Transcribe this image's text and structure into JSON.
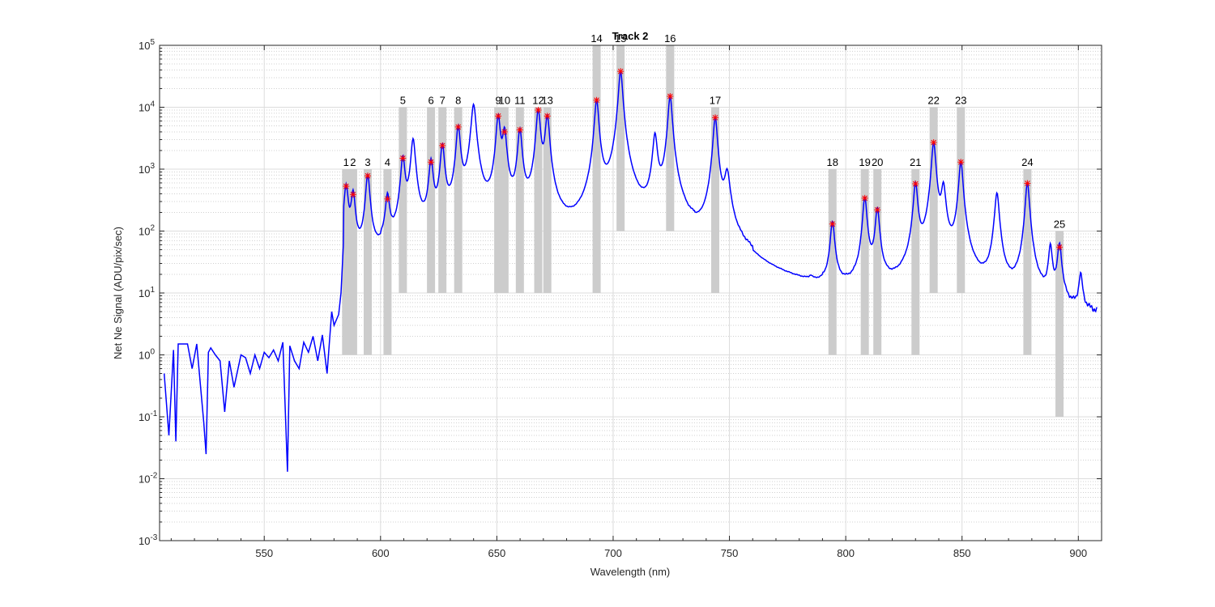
{
  "chart_data": {
    "type": "line",
    "title": "Track 2",
    "xlabel": "Wavelength (nm)",
    "ylabel": "Net Ne Signal (ADU/pix/sec)",
    "xlim": [
      505,
      910
    ],
    "ylim": [
      0.001,
      100000
    ],
    "yscale": "log",
    "grid": true,
    "minor_grid": true,
    "x_ticks": [
      550,
      600,
      650,
      700,
      750,
      800,
      850,
      900
    ],
    "x_tick_labels": [
      "550",
      "600",
      "650",
      "700",
      "750",
      "800",
      "850",
      "900"
    ],
    "y_ticks": [
      {
        "base": "10",
        "exp": "-3",
        "value": 0.001
      },
      {
        "base": "10",
        "exp": "-2",
        "value": 0.01
      },
      {
        "base": "10",
        "exp": "-1",
        "value": 0.1
      },
      {
        "base": "10",
        "exp": "0",
        "value": 1
      },
      {
        "base": "10",
        "exp": "1",
        "value": 10
      },
      {
        "base": "10",
        "exp": "2",
        "value": 100
      },
      {
        "base": "10",
        "exp": "3",
        "value": 1000
      },
      {
        "base": "10",
        "exp": "4",
        "value": 10000
      },
      {
        "base": "10",
        "exp": "5",
        "value": 100000
      }
    ],
    "series_color": "#0000ff",
    "marker_color": "#ff0000",
    "band_color": "#cccccc",
    "background_spectrum": [
      [
        507,
        0.5
      ],
      [
        509,
        0.05
      ],
      [
        511,
        1.2
      ],
      [
        512,
        0.04
      ],
      [
        513,
        1.5
      ],
      [
        517,
        1.5
      ],
      [
        519,
        0.6
      ],
      [
        521,
        1.5
      ],
      [
        524,
        0.08
      ],
      [
        525,
        0.025
      ],
      [
        526,
        1.1
      ],
      [
        527,
        1.3
      ],
      [
        529,
        1.0
      ],
      [
        531,
        0.8
      ],
      [
        533,
        0.12
      ],
      [
        535,
        0.8
      ],
      [
        537,
        0.3
      ],
      [
        540,
        1.0
      ],
      [
        542,
        0.9
      ],
      [
        544,
        0.5
      ],
      [
        546,
        1.0
      ],
      [
        548,
        0.6
      ],
      [
        550,
        1.1
      ],
      [
        552,
        0.9
      ],
      [
        554,
        1.2
      ],
      [
        556,
        0.8
      ],
      [
        558,
        1.6
      ],
      [
        560,
        0.013
      ],
      [
        561,
        1.4
      ],
      [
        563,
        0.8
      ],
      [
        565,
        0.6
      ],
      [
        567,
        1.6
      ],
      [
        569,
        1.1
      ],
      [
        571,
        2.0
      ],
      [
        573,
        0.8
      ],
      [
        575,
        2.1
      ],
      [
        577,
        0.5
      ],
      [
        579,
        5.0
      ],
      [
        580,
        3.0
      ],
      [
        582,
        4.5
      ],
      [
        583,
        10.0
      ],
      [
        584,
        60.0
      ]
    ],
    "broad_features": [
      {
        "center": 640,
        "peak": 11000,
        "width": 1.3
      },
      {
        "center": 614,
        "peak": 3000,
        "width": 1.2
      },
      {
        "center": 718,
        "peak": 3500,
        "width": 1.2
      },
      {
        "center": 749,
        "peak": 800,
        "width": 1.5
      },
      {
        "center": 842,
        "peak": 500,
        "width": 1.2
      },
      {
        "center": 865,
        "peak": 400,
        "width": 1.2
      },
      {
        "center": 888,
        "peak": 50,
        "width": 1.0
      },
      {
        "center": 901,
        "peak": 15,
        "width": 1.0
      },
      {
        "center": 785,
        "peak": 2,
        "width": 1.0
      }
    ],
    "peaks": [
      {
        "label": "1",
        "wavelength": 585.2,
        "signal": 530,
        "band_from": 1,
        "band_to": 1000
      },
      {
        "label": "2",
        "wavelength": 588.2,
        "signal": 390,
        "band_from": 1,
        "band_to": 1000
      },
      {
        "label": "3",
        "wavelength": 594.5,
        "signal": 780,
        "band_from": 1,
        "band_to": 1000
      },
      {
        "label": "4",
        "wavelength": 603.0,
        "signal": 330,
        "band_from": 1,
        "band_to": 1000
      },
      {
        "label": "5",
        "wavelength": 609.6,
        "signal": 1500,
        "band_from": 10,
        "band_to": 10000
      },
      {
        "label": "6",
        "wavelength": 621.7,
        "signal": 1300,
        "band_from": 10,
        "band_to": 10000
      },
      {
        "label": "7",
        "wavelength": 626.6,
        "signal": 2400,
        "band_from": 10,
        "band_to": 10000
      },
      {
        "label": "8",
        "wavelength": 633.4,
        "signal": 4800,
        "band_from": 10,
        "band_to": 10000
      },
      {
        "label": "9",
        "wavelength": 650.6,
        "signal": 7200,
        "band_from": 10,
        "band_to": 10000
      },
      {
        "label": "10",
        "wavelength": 653.3,
        "signal": 4000,
        "band_from": 10,
        "band_to": 10000
      },
      {
        "label": "11",
        "wavelength": 659.9,
        "signal": 4300,
        "band_from": 10,
        "band_to": 10000
      },
      {
        "label": "12",
        "wavelength": 667.8,
        "signal": 9000,
        "band_from": 10,
        "band_to": 10000
      },
      {
        "label": "13",
        "wavelength": 671.7,
        "signal": 7200,
        "band_from": 10,
        "band_to": 10000
      },
      {
        "label": "14",
        "wavelength": 692.9,
        "signal": 13000,
        "band_from": 10,
        "band_to": 100000
      },
      {
        "label": "15",
        "wavelength": 703.2,
        "signal": 38000,
        "band_from": 100,
        "band_to": 100000
      },
      {
        "label": "16",
        "wavelength": 724.5,
        "signal": 15000,
        "band_from": 100,
        "band_to": 100000
      },
      {
        "label": "17",
        "wavelength": 743.9,
        "signal": 6800,
        "band_from": 10,
        "band_to": 10000
      },
      {
        "label": "18",
        "wavelength": 794.3,
        "signal": 130,
        "band_from": 1,
        "band_to": 1000
      },
      {
        "label": "19",
        "wavelength": 808.2,
        "signal": 340,
        "band_from": 1,
        "band_to": 1000
      },
      {
        "label": "20",
        "wavelength": 813.6,
        "signal": 220,
        "band_from": 1,
        "band_to": 1000
      },
      {
        "label": "21",
        "wavelength": 830.0,
        "signal": 580,
        "band_from": 1,
        "band_to": 1000
      },
      {
        "label": "22",
        "wavelength": 837.8,
        "signal": 2700,
        "band_from": 10,
        "band_to": 10000
      },
      {
        "label": "23",
        "wavelength": 849.5,
        "signal": 1300,
        "band_from": 10,
        "band_to": 10000
      },
      {
        "label": "24",
        "wavelength": 878.1,
        "signal": 590,
        "band_from": 1,
        "band_to": 1000
      },
      {
        "label": "25",
        "wavelength": 891.9,
        "signal": 55,
        "band_from": 0.1,
        "band_to": 100
      }
    ]
  }
}
